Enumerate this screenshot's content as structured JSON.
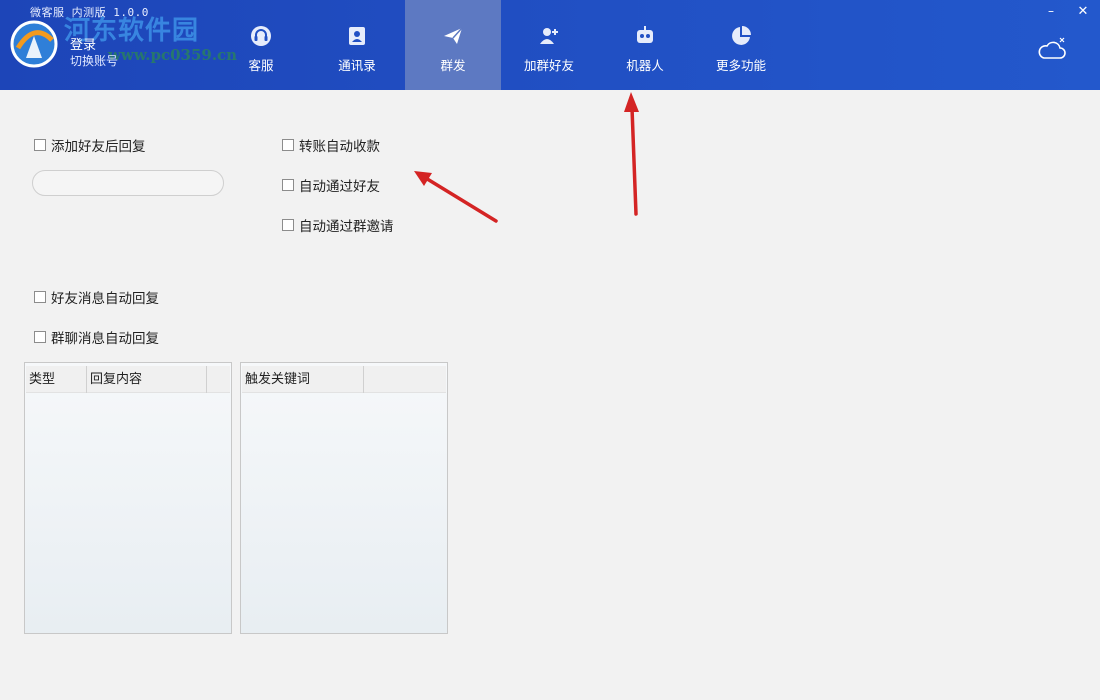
{
  "window": {
    "title": "微客服 内测版 1.0.0",
    "minimize_glyph": "–",
    "close_glyph": "✕"
  },
  "account": {
    "login_label": "登录",
    "switch_label": "切换账号"
  },
  "watermark": {
    "site_name": "河东软件园",
    "url": "www.pc0359.cn"
  },
  "nav": {
    "tabs": [
      {
        "label": "客服",
        "icon": "headset-icon",
        "active": false
      },
      {
        "label": "通讯录",
        "icon": "contacts-book-icon",
        "active": false
      },
      {
        "label": "群发",
        "icon": "paper-plane-icon",
        "active": true
      },
      {
        "label": "加群好友",
        "icon": "add-person-icon",
        "active": false
      },
      {
        "label": "机器人",
        "icon": "robot-icon",
        "active": false
      },
      {
        "label": "更多功能",
        "icon": "pie-chart-icon",
        "active": false
      }
    ]
  },
  "options": {
    "add_friend_reply": "添加好友后回复",
    "auto_accept_transfer": "转账自动收款",
    "auto_accept_friend": "自动通过好友",
    "auto_accept_group_invite": "自动通过群邀请",
    "friend_msg_auto_reply": "好友消息自动回复",
    "group_msg_auto_reply": "群聊消息自动回复"
  },
  "reply_input": {
    "value": "",
    "placeholder": ""
  },
  "reply_table": {
    "columns": [
      "类型",
      "回复内容"
    ],
    "rows": []
  },
  "keyword_table": {
    "columns": [
      "触发关键词"
    ],
    "rows": []
  },
  "colors": {
    "header_bg": "#2150c4",
    "active_tab_bg": "#5d79c2",
    "annotation_arrow": "#d42424"
  }
}
